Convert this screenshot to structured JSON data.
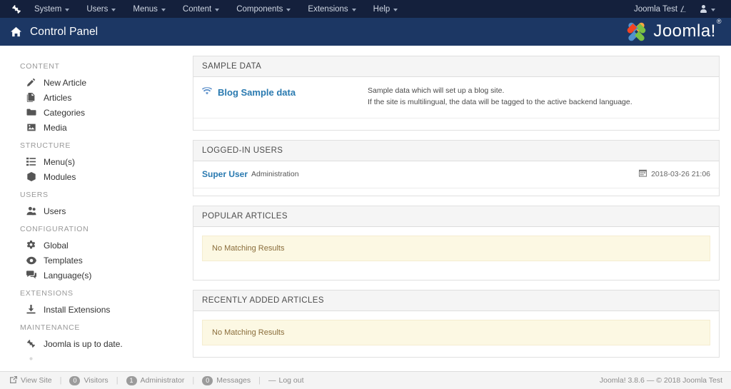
{
  "navbar": {
    "logo_name": "joomla-mark-icon",
    "menus": [
      {
        "label": "System",
        "name": "nav-system"
      },
      {
        "label": "Users",
        "name": "nav-users"
      },
      {
        "label": "Menus",
        "name": "nav-menus"
      },
      {
        "label": "Content",
        "name": "nav-content"
      },
      {
        "label": "Components",
        "name": "nav-components"
      },
      {
        "label": "Extensions",
        "name": "nav-extensions"
      },
      {
        "label": "Help",
        "name": "nav-help"
      }
    ],
    "site_link": "Joomla Test",
    "site_icon": "external-link-icon",
    "user_icon": "user-icon"
  },
  "subhead": {
    "home_icon": "home-icon",
    "title": "Control Panel",
    "brand": "Joomla!",
    "brand_sup": "®"
  },
  "sidebar": {
    "groups": [
      {
        "title": "CONTENT",
        "items": [
          {
            "label": "New Article",
            "icon": "pencil-icon"
          },
          {
            "label": "Articles",
            "icon": "copy-icon"
          },
          {
            "label": "Categories",
            "icon": "folder-icon"
          },
          {
            "label": "Media",
            "icon": "image-icon"
          }
        ]
      },
      {
        "title": "STRUCTURE",
        "items": [
          {
            "label": "Menu(s)",
            "icon": "list-icon"
          },
          {
            "label": "Modules",
            "icon": "cube-icon"
          }
        ]
      },
      {
        "title": "USERS",
        "items": [
          {
            "label": "Users",
            "icon": "users-icon"
          }
        ]
      },
      {
        "title": "CONFIGURATION",
        "items": [
          {
            "label": "Global",
            "icon": "gear-icon"
          },
          {
            "label": "Templates",
            "icon": "eye-icon"
          },
          {
            "label": "Language(s)",
            "icon": "comments-icon"
          }
        ]
      },
      {
        "title": "EXTENSIONS",
        "items": [
          {
            "label": "Install Extensions",
            "icon": "download-icon"
          }
        ]
      },
      {
        "title": "MAINTENANCE",
        "items": [
          {
            "label": "Joomla is up to date.",
            "icon": "joomla-mark-icon"
          }
        ]
      }
    ]
  },
  "main": {
    "sample_data": {
      "heading": "SAMPLE DATA",
      "link_label": "Blog Sample data",
      "link_icon": "wifi-icon",
      "desc_line1": "Sample data which will set up a blog site.",
      "desc_line2": "If the site is multilingual, the data will be tagged to the active backend language."
    },
    "logged_in_users": {
      "heading": "LOGGED-IN USERS",
      "user_name": "Super User",
      "user_role": "Administration",
      "date_icon": "calendar-icon",
      "date": "2018-03-26 21:06"
    },
    "popular_articles": {
      "heading": "POPULAR ARTICLES",
      "empty_message": "No Matching Results"
    },
    "recently_added_articles": {
      "heading": "RECENTLY ADDED ARTICLES",
      "empty_message": "No Matching Results"
    }
  },
  "footer": {
    "view_site": "View Site",
    "view_site_icon": "external-link-icon",
    "visitors_count": "0",
    "visitors_label": "Visitors",
    "administrator_count": "1",
    "administrator_label": "Administrator",
    "messages_count": "0",
    "messages_label": "Messages",
    "logout_label": "Log out",
    "logout_icon": "minus-icon",
    "copyright": "Joomla! 3.8.6  —  © 2018 Joomla Test"
  },
  "colors": {
    "navbar_bg": "#14203c",
    "subhead_bg": "#1c3764",
    "link_blue": "#2a7ab0",
    "alert_bg": "#fcf8e3",
    "alert_text": "#8a6d3b"
  }
}
